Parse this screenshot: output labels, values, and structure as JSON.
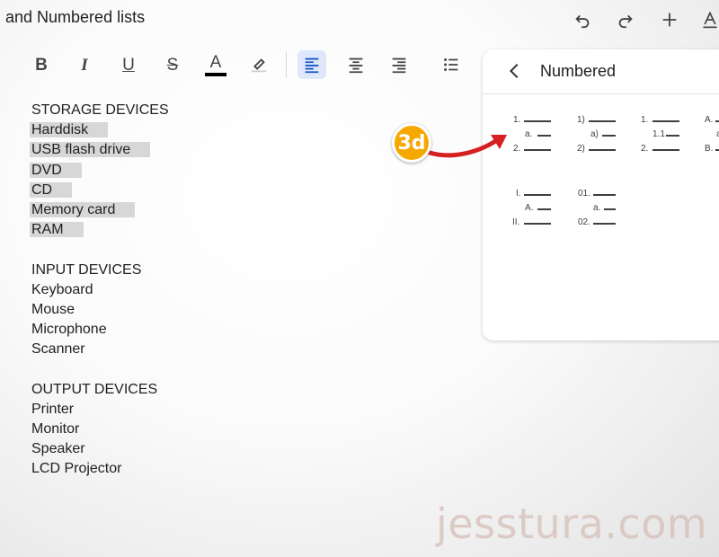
{
  "header": {
    "title": "and Numbered lists",
    "icons": [
      "undo-icon",
      "redo-icon",
      "add-icon",
      "text-format-icon"
    ]
  },
  "toolbar": {
    "bold": "B",
    "italic": "I",
    "underline": "U",
    "strikethrough": "S",
    "text_color": "A",
    "text_color_value": "#000000",
    "icons": [
      "highlight-icon",
      "align-left-icon",
      "align-center-icon",
      "align-right-icon",
      "bulleted-list-icon"
    ]
  },
  "document": {
    "storage_heading": "STORAGE DEVICES",
    "storage_items": [
      "Harddisk",
      "USB flash drive",
      "DVD",
      "CD",
      "Memory card",
      "RAM"
    ],
    "input_heading": "INPUT DEVICES",
    "input_items": [
      "Keyboard",
      "Mouse",
      "Microphone",
      "Scanner"
    ],
    "output_heading": "OUTPUT DEVICES",
    "output_items": [
      "Printer",
      "Monitor",
      "Speaker",
      "LCD Projector"
    ]
  },
  "panel": {
    "title": "Numbered",
    "styles": [
      {
        "l1": "1.",
        "l2": "a.",
        "l3": "2."
      },
      {
        "l1": "1)",
        "l2": "a)",
        "l3": "2)"
      },
      {
        "l1": "1.",
        "l2": "1.1",
        "l3": "2."
      },
      {
        "l1": "A.",
        "l2": "a",
        "l3": "B."
      },
      {
        "l1": "I.",
        "l2": "A.",
        "l3": "II."
      },
      {
        "l1": "01.",
        "l2": "a.",
        "l3": "02."
      }
    ]
  },
  "annotation": {
    "step_badge": "3d",
    "badge_color": "#f5a800",
    "arrow_color": "#d62020"
  },
  "watermark": "jesstura.com"
}
